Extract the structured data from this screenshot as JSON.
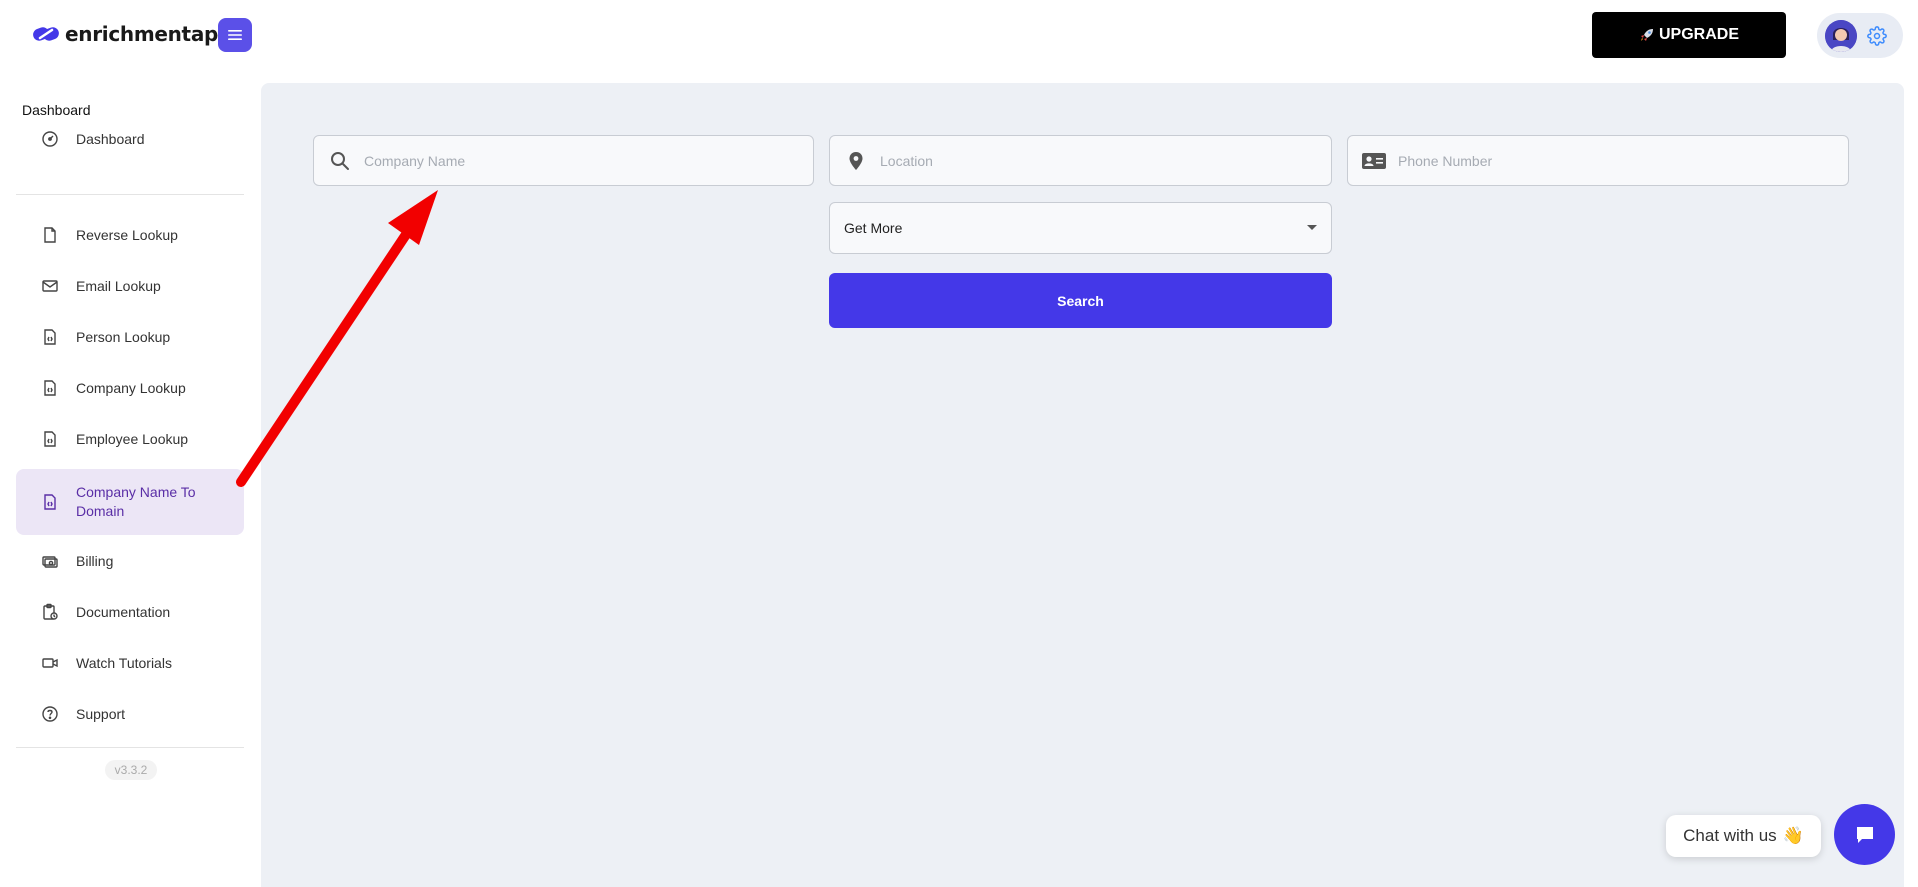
{
  "header": {
    "logo_text": "enrichmentapi",
    "upgrade_label": "UPGRADE",
    "upgrade_icon": "rocket-icon"
  },
  "sidebar": {
    "heading": "Dashboard",
    "items": [
      {
        "label": "Dashboard",
        "icon": "dashboard-icon"
      },
      {
        "label": "Reverse Lookup",
        "icon": "file-icon"
      },
      {
        "label": "Email Lookup",
        "icon": "mail-icon"
      },
      {
        "label": "Person Lookup",
        "icon": "file-code-icon"
      },
      {
        "label": "Company Lookup",
        "icon": "file-code-icon"
      },
      {
        "label": "Employee Lookup",
        "icon": "file-code-icon"
      },
      {
        "label": "Company Name To Domain",
        "icon": "file-code-icon",
        "active": true
      },
      {
        "label": "Billing",
        "icon": "billing-icon"
      },
      {
        "label": "Documentation",
        "icon": "documentation-icon"
      },
      {
        "label": "Watch Tutorials",
        "icon": "video-icon"
      },
      {
        "label": "Support",
        "icon": "help-icon"
      }
    ],
    "version": "v3.3.2"
  },
  "search_form": {
    "company_placeholder": "Company Name",
    "location_placeholder": "Location",
    "phone_placeholder": "Phone Number",
    "select_value": "Get More",
    "search_label": "Search"
  },
  "chat": {
    "label": "Chat with us",
    "emoji": "👋"
  },
  "colors": {
    "accent": "#4438e8",
    "annotation": "#f20000",
    "active_bg": "#ece6f6"
  }
}
